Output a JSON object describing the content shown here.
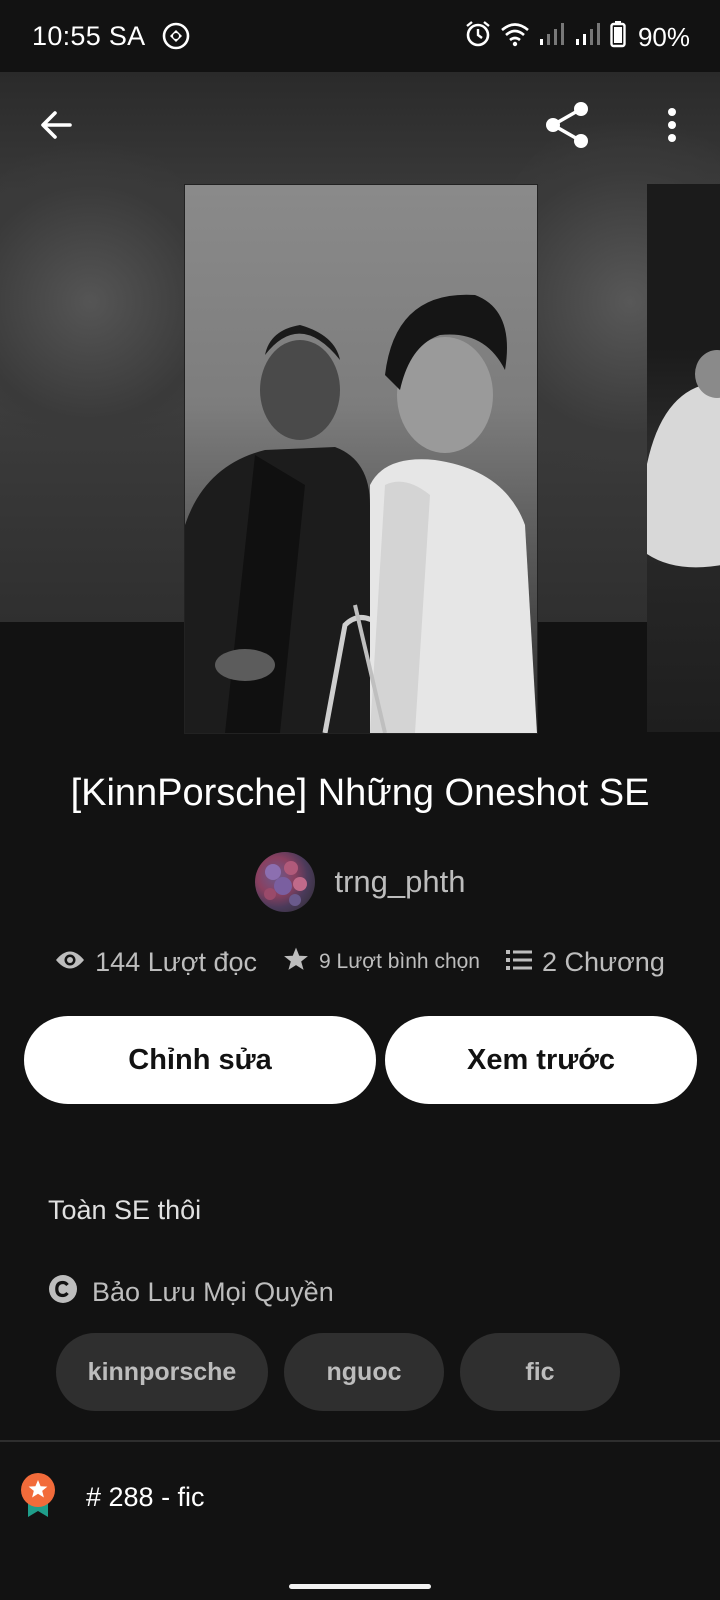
{
  "status_bar": {
    "time": "10:55 SA",
    "battery": "90%"
  },
  "icons": {
    "back": "arrow-left-icon",
    "share": "share-icon",
    "more": "more-vertical-icon",
    "views": "eye-icon",
    "votes": "star-icon",
    "chapters": "list-icon",
    "copyright": "copyright-icon",
    "rank": "award-badge-icon"
  },
  "story": {
    "title": "[KinnPorsche] Những Oneshot SE",
    "author": "trng_phth",
    "views": "144 Lượt đọc",
    "votes": "9 Lượt bình chọn",
    "chapters": "2 Chương",
    "description": "Toàn SE thôi",
    "copyright": "Bảo Lưu Mọi Quyền",
    "tags": [
      "kinnporsche",
      "nguoc",
      "fic"
    ],
    "rank": "# 288 - fic"
  },
  "actions": {
    "edit_label": "Chỉnh sửa",
    "preview_label": "Xem trước"
  },
  "colors": {
    "background": "#121212",
    "tag_background": "#2f2f2f",
    "badge_orange": "#f26b3a",
    "badge_ribbon": "#1f9e8a"
  }
}
